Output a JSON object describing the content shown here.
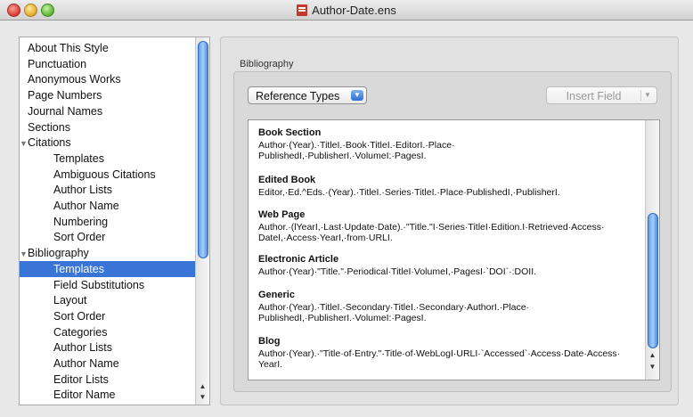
{
  "window": {
    "title": "Author-Date.ens"
  },
  "sidebar": {
    "items": [
      {
        "label": "About This Style",
        "level": 0
      },
      {
        "label": "Punctuation",
        "level": 0
      },
      {
        "label": "Anonymous Works",
        "level": 0
      },
      {
        "label": "Page Numbers",
        "level": 0
      },
      {
        "label": "Journal Names",
        "level": 0
      },
      {
        "label": "Sections",
        "level": 0
      },
      {
        "label": "Citations",
        "level": 0,
        "disclosure": "▼"
      },
      {
        "label": "Templates",
        "level": 1
      },
      {
        "label": "Ambiguous Citations",
        "level": 1
      },
      {
        "label": "Author Lists",
        "level": 1
      },
      {
        "label": "Author Name",
        "level": 1
      },
      {
        "label": "Numbering",
        "level": 1
      },
      {
        "label": "Sort Order",
        "level": 1
      },
      {
        "label": "Bibliography",
        "level": 0,
        "disclosure": "▼"
      },
      {
        "label": "Templates",
        "level": 1,
        "selected": true
      },
      {
        "label": "Field Substitutions",
        "level": 1
      },
      {
        "label": "Layout",
        "level": 1
      },
      {
        "label": "Sort Order",
        "level": 1
      },
      {
        "label": "Categories",
        "level": 1
      },
      {
        "label": "Author Lists",
        "level": 1
      },
      {
        "label": "Author Name",
        "level": 1
      },
      {
        "label": "Editor Lists",
        "level": 1
      },
      {
        "label": "Editor Name",
        "level": 1
      }
    ]
  },
  "panel": {
    "group_label": "Bibliography",
    "reference_types_label": "Reference Types",
    "insert_field_label": "Insert Field"
  },
  "entries": [
    {
      "title": "Book Section",
      "lines": [
        "Author·(Year).·TitleI.·Book·TitleI.·EditorI.·Place·",
        "PublishedI,·PublisherI.·VolumeI:·PagesI."
      ]
    },
    {
      "title": "Edited Book",
      "lines": [
        "Editor,·Ed.^Eds.·(Year).·TitleI.·Series·TitleI.·Place·PublishedI,·PublisherI."
      ]
    },
    {
      "title": "Web Page",
      "lines": [
        "Author.·(lYearI,·Last·Update·Date).·\"Title.\"I·Series·TitleI·Edition.I·Retrieved·Access·",
        "DateI,·Access·YearI,·from·URLI."
      ]
    },
    {
      "title": "Electronic Article",
      "lines": [
        "Author·(Year)·\"Title.\"·Periodical·TitleI·VolumeI,·PagesI·`DOI`·:DOII."
      ]
    },
    {
      "title": "Generic",
      "lines": [
        "Author·(Year).·TitleI.·Secondary·TitleI.·Secondary·AuthorI.·Place·",
        "PublishedI,·PublisherI.·VolumeI:·PagesI."
      ]
    },
    {
      "title": "Blog",
      "lines": [
        "Author·(Year).·\"Title·of·Entry.\"·Title·of·WebLogI·URLI·`Accessed`·Access·Date·Access·",
        "YearI."
      ]
    }
  ],
  "icons": {
    "close": "close-button",
    "minimize": "minimize-button",
    "zoom": "zoom-button",
    "document": "document-icon"
  },
  "colors": {
    "selection": "#3875d7",
    "scroll_thumb": "#5c9ee8"
  }
}
